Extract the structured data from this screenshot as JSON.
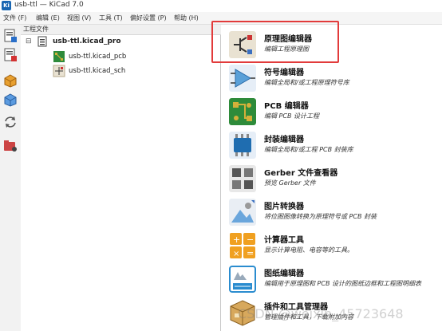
{
  "window": {
    "title": "usb-ttl — KiCad 7.0",
    "app_badge": "Ki"
  },
  "menubar": {
    "items": [
      "文件 (F)",
      "编辑 (E)",
      "视图 (V)",
      "工具 (T)",
      "偏好设置 (P)",
      "帮助 (H)"
    ]
  },
  "tree": {
    "header": "工程文件",
    "project": "usb-ttl.kicad_pro",
    "files": [
      "usb-ttl.kicad_pcb",
      "usb-ttl.kicad_sch"
    ],
    "expander": "⊟"
  },
  "tools": [
    {
      "title": "原理图编辑器",
      "desc": "编辑工程原理图",
      "icon": "schematic-editor-icon",
      "color": "#e9e2d2"
    },
    {
      "title": "符号编辑器",
      "desc": "编辑全局和/或工程原理符号库",
      "icon": "symbol-editor-icon",
      "color": "#5aa0d8"
    },
    {
      "title": "PCB 编辑器",
      "desc": "编辑 PCB 设计工程",
      "icon": "pcb-editor-icon",
      "color": "#2e8b3a"
    },
    {
      "title": "封装编辑器",
      "desc": "编辑全局和/或工程 PCB 封装库",
      "icon": "footprint-editor-icon",
      "color": "#1f6db0"
    },
    {
      "title": "Gerber 文件查看器",
      "desc": "预览 Gerber 文件",
      "icon": "gerber-viewer-icon",
      "color": "#555555"
    },
    {
      "title": "图片转换器",
      "desc": "将位图图像转换为原理符号或 PCB 封装",
      "icon": "image-converter-icon",
      "color": "#6aa6dc"
    },
    {
      "title": "计算器工具",
      "desc": "显示计算电阻、电容等的工具。",
      "icon": "calculator-icon",
      "color": "#f0a020"
    },
    {
      "title": "图纸编辑器",
      "desc": "编辑用于原理图和 PCB 设计的图纸边框和工程图明细表",
      "icon": "drawing-sheet-editor-icon",
      "color": "#2a8ccf"
    },
    {
      "title": "插件和工具管理器",
      "desc": "管理插件和工具，下载附加内容",
      "icon": "plugin-manager-icon",
      "color": "#c89a50"
    }
  ],
  "watermark": "CSDN @weixin_45723648"
}
